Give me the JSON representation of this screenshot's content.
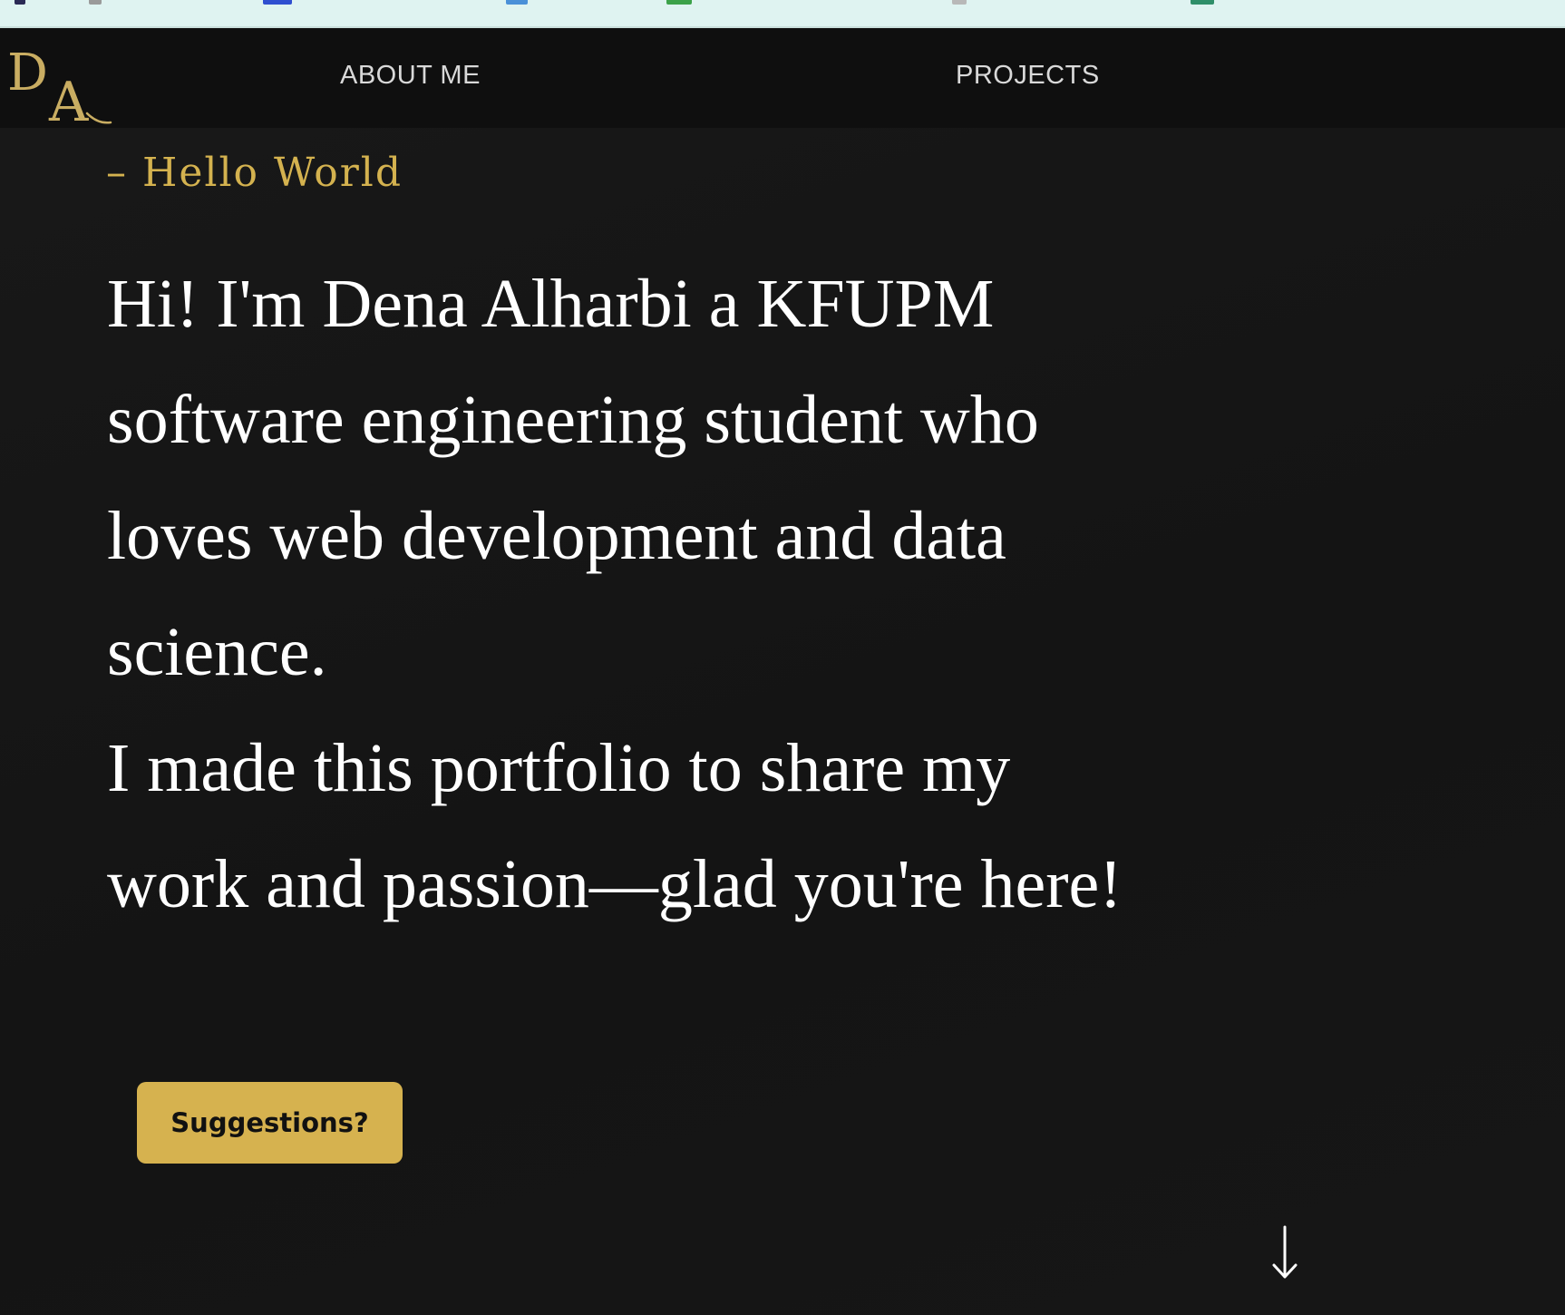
{
  "logo": {
    "monogram_first": "D",
    "monogram_second": "A",
    "color": "#c9ad62"
  },
  "nav": {
    "about_label": "ABOUT ME",
    "projects_label": "PROJECTS"
  },
  "hero": {
    "greeting": "– Hello World",
    "intro_paragraph_1": "Hi! I'm Dena Alharbi a KFUPM software engineering student who loves web development and data science.",
    "intro_paragraph_2": "I made this portfolio to share my work and passion—glad you're here!",
    "cta_label": "Suggestions?",
    "scroll_icon": "arrow-down-icon"
  },
  "colors": {
    "accent": "#d6b24f",
    "background": "#161616",
    "navbar": "#0f0f0f",
    "text": "#ffffff"
  }
}
